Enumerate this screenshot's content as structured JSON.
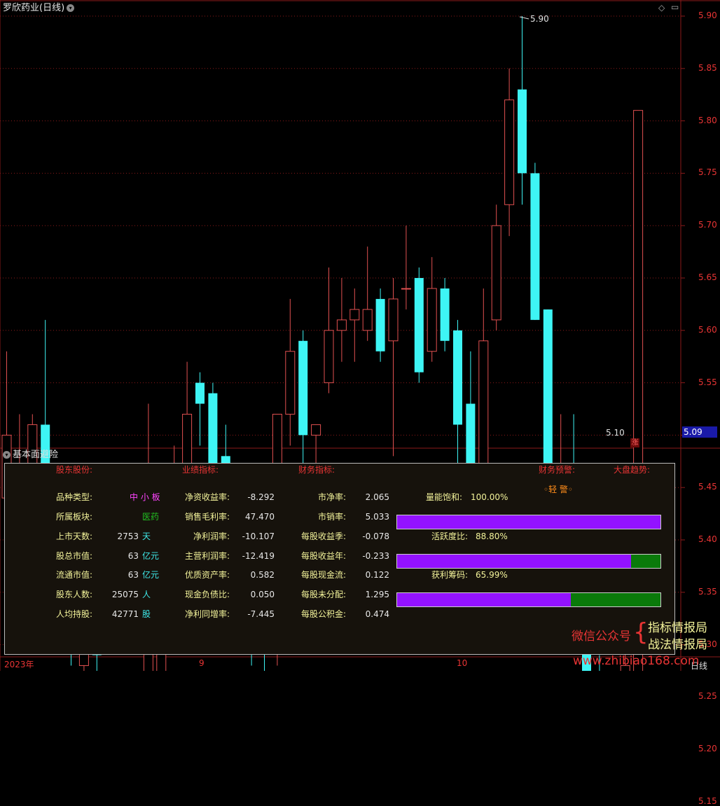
{
  "title": "罗欣药业(日线)",
  "top_icons": {
    "diamond": "◇",
    "window": "▭"
  },
  "price_axis": [
    "5.90",
    "5.85",
    "5.80",
    "5.75",
    "5.70",
    "5.65",
    "5.60",
    "5.55",
    "5.50",
    "5.45",
    "5.40",
    "5.35",
    "5.30",
    "5.25",
    "5.20",
    "5.15"
  ],
  "high_label": "5.90",
  "low_label": "5.10",
  "current_price": "5.09",
  "zhang_badge": "涨",
  "panel": {
    "title": "基本面避险",
    "headers": {
      "shareholders": "股东股份:",
      "performance": "业绩指标:",
      "finance": "财务指标:",
      "warning": "财务预警:",
      "market": "大盘趋势:"
    },
    "warning_value": "◦轻 警◦",
    "col1": [
      {
        "label": "品种类型:",
        "value": "",
        "unit": "中 小 板"
      },
      {
        "label": "所属板块:",
        "value": "",
        "unit": "医药"
      },
      {
        "label": "上市天数:",
        "value": "2753",
        "unit": "天"
      },
      {
        "label": "股总市值:",
        "value": "63",
        "unit": "亿元"
      },
      {
        "label": "流通市值:",
        "value": "63",
        "unit": "亿元"
      },
      {
        "label": "股东人数:",
        "value": "25075",
        "unit": "人"
      },
      {
        "label": "人均持股:",
        "value": "42771",
        "unit": "股"
      }
    ],
    "col2": [
      {
        "label": "净资收益率:",
        "value": "-8.292"
      },
      {
        "label": "销售毛利率:",
        "value": "47.470"
      },
      {
        "label": "净利润率:",
        "value": "-10.107"
      },
      {
        "label": "主营利润率:",
        "value": "-12.419"
      },
      {
        "label": "优质资产率:",
        "value": "0.582"
      },
      {
        "label": "现金负债比:",
        "value": "0.050"
      },
      {
        "label": "净利同增率:",
        "value": "-7.445"
      }
    ],
    "col3": [
      {
        "label": "市净率:",
        "value": "2.065"
      },
      {
        "label": "市销率:",
        "value": "5.033"
      },
      {
        "label": "每股收益季:",
        "value": "-0.078"
      },
      {
        "label": "每股收益年:",
        "value": "-0.233"
      },
      {
        "label": "每股现金流:",
        "value": "0.122"
      },
      {
        "label": "每股未分配:",
        "value": "1.295"
      },
      {
        "label": "每股公积金:",
        "value": "0.474"
      }
    ],
    "bars": [
      {
        "label": "量能饱和:",
        "value": "100.00%",
        "fraction": 1.0
      },
      {
        "label": "活跃度比:",
        "value": "88.80%",
        "fraction": 0.888
      },
      {
        "label": "获利筹码:",
        "value": "65.99%",
        "fraction": 0.6599
      }
    ]
  },
  "x_axis": {
    "year": "2023年",
    "m9": "9",
    "m10": "10"
  },
  "right_label": "日线",
  "watermark": {
    "wechat": "微信公众号",
    "brand1": "指标情报局",
    "brand2": "战法情报局",
    "site": "www.zhibiao168.com"
  },
  "colors": {
    "up": "#e05050",
    "down": "#3ef5f5",
    "grid": "#8b1a1a",
    "purple": "#9312ff",
    "green": "#0a7a0a"
  },
  "candles": [
    {
      "o": 5.44,
      "h": 5.58,
      "l": 5.43,
      "c": 5.5
    },
    {
      "o": 5.43,
      "h": 5.52,
      "l": 5.33,
      "c": 5.45
    },
    {
      "o": 5.46,
      "h": 5.52,
      "l": 5.36,
      "c": 5.51
    },
    {
      "o": 5.51,
      "h": 5.61,
      "l": 5.46,
      "c": 5.46
    },
    {
      "o": 5.41,
      "h": 5.47,
      "l": 5.34,
      "c": 5.45
    },
    {
      "o": 5.43,
      "h": 5.44,
      "l": 5.28,
      "c": 5.31
    },
    {
      "o": 5.28,
      "h": 5.4,
      "l": 5.24,
      "c": 5.31
    },
    {
      "o": 5.31,
      "h": 5.34,
      "l": 5.16,
      "c": 5.29
    },
    {
      "o": 5.25,
      "h": 5.26,
      "l": 5.17,
      "c": 5.2
    },
    {
      "o": 5.21,
      "h": 5.27,
      "l": 5.13,
      "c": 5.24
    },
    {
      "o": 5.24,
      "h": 5.27,
      "l": 5.19,
      "c": 5.21
    },
    {
      "o": 5.22,
      "h": 5.53,
      "l": 5.19,
      "c": 5.46
    },
    {
      "o": 5.19,
      "h": 5.39,
      "l": 5.19,
      "c": 5.38
    },
    {
      "o": 5.44,
      "h": 5.49,
      "l": 5.38,
      "c": 5.47
    },
    {
      "o": 5.46,
      "h": 5.57,
      "l": 5.44,
      "c": 5.52
    },
    {
      "o": 5.55,
      "h": 5.56,
      "l": 5.49,
      "c": 5.53
    },
    {
      "o": 5.54,
      "h": 5.55,
      "l": 5.41,
      "c": 5.47
    },
    {
      "o": 5.48,
      "h": 5.51,
      "l": 5.4,
      "c": 5.43
    },
    {
      "o": 5.43,
      "h": 5.46,
      "l": 5.39,
      "c": 5.46
    },
    {
      "o": 5.46,
      "h": 5.46,
      "l": 5.28,
      "c": 5.3
    },
    {
      "o": 5.34,
      "h": 5.35,
      "l": 5.27,
      "c": 5.32
    },
    {
      "o": 5.3,
      "h": 5.52,
      "l": 5.28,
      "c": 5.52
    },
    {
      "o": 5.52,
      "h": 5.63,
      "l": 5.49,
      "c": 5.58
    },
    {
      "o": 5.59,
      "h": 5.6,
      "l": 5.47,
      "c": 5.5
    },
    {
      "o": 5.5,
      "h": 5.51,
      "l": 5.45,
      "c": 5.51
    },
    {
      "o": 5.55,
      "h": 5.66,
      "l": 5.54,
      "c": 5.6
    },
    {
      "o": 5.6,
      "h": 5.65,
      "l": 5.57,
      "c": 5.61
    },
    {
      "o": 5.61,
      "h": 5.64,
      "l": 5.57,
      "c": 5.62
    },
    {
      "o": 5.6,
      "h": 5.68,
      "l": 5.59,
      "c": 5.62
    },
    {
      "o": 5.63,
      "h": 5.64,
      "l": 5.57,
      "c": 5.58
    },
    {
      "o": 5.59,
      "h": 5.65,
      "l": 5.48,
      "c": 5.63
    },
    {
      "o": 5.64,
      "h": 5.7,
      "l": 5.62,
      "c": 5.64
    },
    {
      "o": 5.65,
      "h": 5.66,
      "l": 5.55,
      "c": 5.56
    },
    {
      "o": 5.58,
      "h": 5.67,
      "l": 5.57,
      "c": 5.64
    },
    {
      "o": 5.64,
      "h": 5.65,
      "l": 5.58,
      "c": 5.59
    },
    {
      "o": 5.6,
      "h": 5.61,
      "l": 5.42,
      "c": 5.51
    },
    {
      "o": 5.53,
      "h": 5.58,
      "l": 5.45,
      "c": 5.45
    },
    {
      "o": 5.46,
      "h": 5.64,
      "l": 5.45,
      "c": 5.59
    },
    {
      "o": 5.61,
      "h": 5.72,
      "l": 5.6,
      "c": 5.7
    },
    {
      "o": 5.72,
      "h": 5.85,
      "l": 5.69,
      "c": 5.82
    },
    {
      "o": 5.83,
      "h": 5.9,
      "l": 5.72,
      "c": 5.75
    },
    {
      "o": 5.75,
      "h": 5.76,
      "l": 5.61,
      "c": 5.61
    },
    {
      "o": 5.62,
      "h": 5.62,
      "l": 5.44,
      "c": 5.46
    },
    {
      "o": 5.42,
      "h": 5.52,
      "l": 5.35,
      "c": 5.45
    },
    {
      "o": 5.43,
      "h": 5.52,
      "l": 5.4,
      "c": 5.4
    },
    {
      "o": 5.37,
      "h": 5.41,
      "l": 5.22,
      "c": 5.24
    },
    {
      "o": 5.25,
      "h": 5.29,
      "l": 5.1,
      "c": 5.2
    },
    {
      "o": 5.2,
      "h": 5.26,
      "l": 5.18,
      "c": 5.2
    },
    {
      "o": 5.18,
      "h": 5.3,
      "l": 5.14,
      "c": 5.28
    },
    {
      "o": 5.25,
      "h": 5.81,
      "l": 5.23,
      "c": 5.81
    }
  ]
}
